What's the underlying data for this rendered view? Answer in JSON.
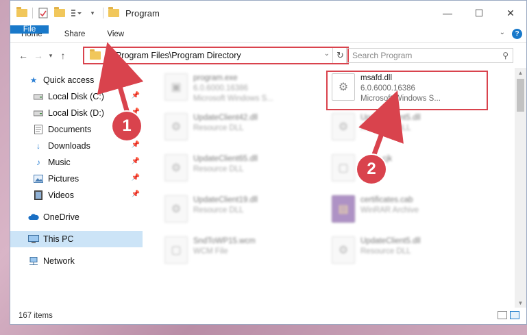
{
  "window": {
    "title": "Program",
    "controls": {
      "minimize": "—",
      "maximize": "☐",
      "close": "✕"
    }
  },
  "ribbon": {
    "tabs": [
      "File",
      "Home",
      "Share",
      "View"
    ]
  },
  "address": {
    "path": "C:\\Program Files\\Program Directory"
  },
  "search": {
    "placeholder": "Search Program"
  },
  "sidebar": {
    "items": [
      {
        "label": "Quick access",
        "icon": "star-icon"
      },
      {
        "label": "Local Disk (C:)",
        "icon": "drive-icon",
        "pinned": true
      },
      {
        "label": "Local Disk (D:)",
        "icon": "drive-icon",
        "pinned": true
      },
      {
        "label": "Documents",
        "icon": "documents-icon",
        "pinned": true
      },
      {
        "label": "Downloads",
        "icon": "download-icon",
        "pinned": true
      },
      {
        "label": "Music",
        "icon": "music-icon",
        "pinned": true
      },
      {
        "label": "Pictures",
        "icon": "pictures-icon",
        "pinned": true
      },
      {
        "label": "Videos",
        "icon": "videos-icon",
        "pinned": true
      },
      {
        "label": "OneDrive",
        "icon": "cloud-icon"
      },
      {
        "label": "This PC",
        "icon": "computer-icon",
        "selected": true
      },
      {
        "label": "Network",
        "icon": "network-icon"
      }
    ]
  },
  "files": [
    {
      "name": "program.exe",
      "sub1": "6.0.6000.16386",
      "sub2": "Microsoft Windows S...",
      "blurred": true
    },
    {
      "name": "msafd.dll",
      "sub1": "6.0.6000.16386",
      "sub2": "Microsoft Windows S...",
      "blurred": false
    },
    {
      "name": "UpdateClient42.dll",
      "sub1": "Resource DLL",
      "blurred": true
    },
    {
      "name": "UpdateClient5.dll",
      "sub1": "Resource DLL",
      "blurred": true
    },
    {
      "name": "UpdateClient65.dll",
      "sub1": "Resource DLL",
      "blurred": true
    },
    {
      "name": "...ean.cjk",
      "sub1": "...e",
      "blurred": true
    },
    {
      "name": "UpdateClient19.dll",
      "sub1": "Resource DLL",
      "blurred": true
    },
    {
      "name": "certificates.cab",
      "sub1": "WinRAR Archive",
      "blurred": true
    },
    {
      "name": "SndToWP15.wcm",
      "sub1": "WCM File",
      "blurred": true
    },
    {
      "name": "UpdateClient5.dll",
      "sub1": "Resource DLL",
      "blurred": true
    }
  ],
  "status": {
    "count": "167 items"
  },
  "annotations": {
    "step1": "1",
    "step2": "2"
  },
  "colors": {
    "accent": "#1979ca",
    "highlight": "#d9434d"
  }
}
